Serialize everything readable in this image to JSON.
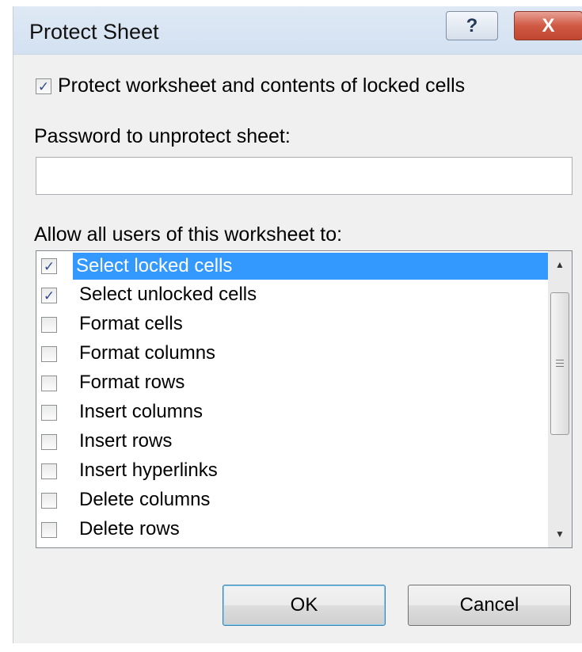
{
  "dialog": {
    "title": "Protect Sheet",
    "help_glyph": "?",
    "close_glyph": "X"
  },
  "protect": {
    "label": "Protect worksheet and contents of locked cells",
    "checked": true
  },
  "password": {
    "label": "Password to unprotect sheet:",
    "value": ""
  },
  "allow": {
    "label": "Allow all users of this worksheet to:",
    "items": [
      {
        "label": "Select locked cells",
        "checked": true,
        "selected": true
      },
      {
        "label": "Select unlocked cells",
        "checked": true,
        "selected": false
      },
      {
        "label": "Format cells",
        "checked": false,
        "selected": false
      },
      {
        "label": "Format columns",
        "checked": false,
        "selected": false
      },
      {
        "label": "Format rows",
        "checked": false,
        "selected": false
      },
      {
        "label": "Insert columns",
        "checked": false,
        "selected": false
      },
      {
        "label": "Insert rows",
        "checked": false,
        "selected": false
      },
      {
        "label": "Insert hyperlinks",
        "checked": false,
        "selected": false
      },
      {
        "label": "Delete columns",
        "checked": false,
        "selected": false
      },
      {
        "label": "Delete rows",
        "checked": false,
        "selected": false
      }
    ]
  },
  "buttons": {
    "ok": "OK",
    "cancel": "Cancel"
  },
  "icons": {
    "help": "help-icon",
    "close": "close-icon",
    "check": "checkmark-icon",
    "scroll_up": "scroll-up-arrow-icon",
    "scroll_down": "scroll-down-arrow-icon"
  },
  "colors": {
    "selection": "#3399ff",
    "close_button": "#c94b36",
    "titlebar": "#d8e4f2"
  }
}
